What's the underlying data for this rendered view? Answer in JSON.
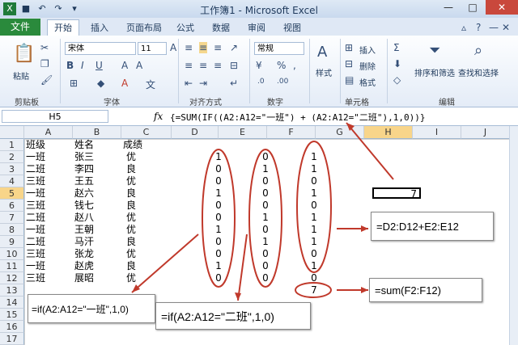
{
  "window": {
    "title": "工作簿1 - Microsoft Excel"
  },
  "tabs": [
    "文件",
    "开始",
    "插入",
    "页面布局",
    "公式",
    "数据",
    "审阅",
    "视图"
  ],
  "active_tab": "开始",
  "ribbon": {
    "paste": "粘贴",
    "font_name": "宋体",
    "font_size": "11",
    "number_format": "常规",
    "style_btn": "样式",
    "insert_btn": "插入",
    "delete_btn": "删除",
    "format_btn": "格式",
    "sort_filter_btn": "排序和筛选",
    "find_select_btn": "查找和选择",
    "groups": {
      "clipboard": "剪贴板",
      "font": "字体",
      "align": "对齐方式",
      "number": "数字",
      "cells": "单元格",
      "editing": "编辑"
    }
  },
  "formula_bar": {
    "name_box": "H5",
    "fx": "fx",
    "formula": "{=SUM(IF((A2:A12=\"一班\") + (A2:A12=\"二班\"),1,0))}"
  },
  "columns": [
    "A",
    "B",
    "C",
    "D",
    "E",
    "F",
    "G",
    "H",
    "I",
    "J"
  ],
  "rows": [
    "1",
    "2",
    "3",
    "4",
    "5",
    "6",
    "7",
    "8",
    "9",
    "10",
    "11",
    "12",
    "13",
    "14",
    "15",
    "16",
    "17"
  ],
  "data": {
    "headers": [
      "班级",
      "姓名",
      "成绩"
    ],
    "records": [
      [
        "一班",
        "张三",
        "优",
        "1",
        "0",
        "1"
      ],
      [
        "二班",
        "李四",
        "良",
        "0",
        "1",
        "1"
      ],
      [
        "三班",
        "王五",
        "优",
        "0",
        "0",
        "0"
      ],
      [
        "一班",
        "赵六",
        "良",
        "1",
        "0",
        "1"
      ],
      [
        "三班",
        "钱七",
        "良",
        "0",
        "0",
        "0"
      ],
      [
        "二班",
        "赵八",
        "优",
        "0",
        "1",
        "1"
      ],
      [
        "一班",
        "王朝",
        "优",
        "1",
        "0",
        "1"
      ],
      [
        "二班",
        "马汗",
        "良",
        "0",
        "1",
        "1"
      ],
      [
        "三班",
        "张龙",
        "优",
        "0",
        "0",
        "0"
      ],
      [
        "一班",
        "赵虎",
        "良",
        "1",
        "0",
        "1"
      ],
      [
        "三班",
        "展昭",
        "优",
        "0",
        "0",
        "0"
      ]
    ],
    "f13": "7",
    "h5": "7"
  },
  "annotations": {
    "sum_de": "=D2:D12+E2:E12",
    "sum_f": "=sum(F2:F12)",
    "if_yiban": "=if(A2:A12=\"一班\",1,0)",
    "if_erban": "=if(A2:A12=\"二班\",1,0)"
  },
  "colors": {
    "annotation_red": "#c0392b",
    "file_tab": "#2a8a3c"
  }
}
